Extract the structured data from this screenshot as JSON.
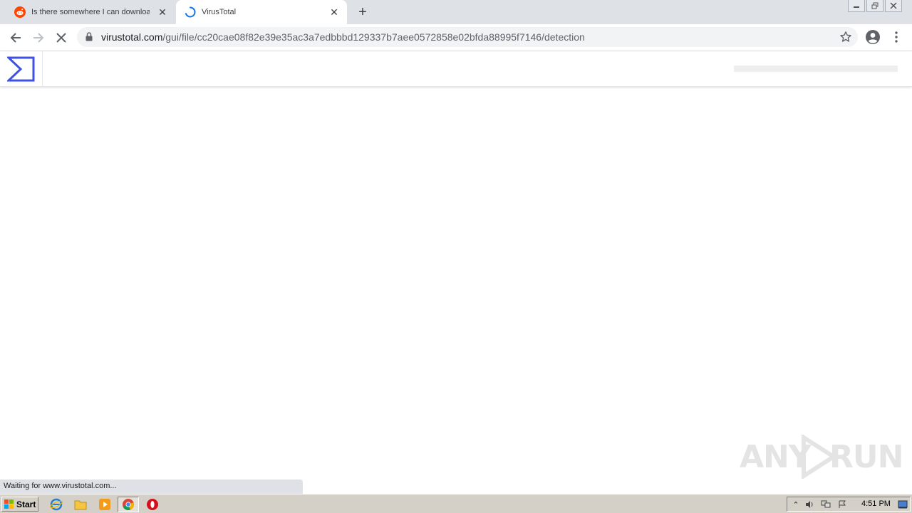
{
  "browser": {
    "tabs": [
      {
        "title": "Is there somewhere I can download",
        "favicon": "reddit-icon",
        "active": false
      },
      {
        "title": "VirusTotal",
        "favicon": "loading-spinner-icon",
        "active": true
      }
    ],
    "close_glyph": "✕",
    "newtab_glyph": "+",
    "url_host": "virustotal.com",
    "url_path": "/gui/file/cc20cae08f82e39e35ac3a7edbbbd129337b7aee0572858e02bfda88995f7146/detection",
    "status_text": "Waiting for www.virustotal.com..."
  },
  "page": {
    "logo": "virustotal-sigma-logo",
    "accent_color": "#3f51e5"
  },
  "watermark": {
    "text_left": "ANY",
    "text_right": "RUN"
  },
  "taskbar": {
    "start_label": "Start",
    "clock": "4:51 PM"
  },
  "colors": {
    "tabstrip": "#dee1e6",
    "omnibox": "#f1f3f4",
    "taskbar": "#d4d0c8",
    "reddit": "#ff4500"
  }
}
